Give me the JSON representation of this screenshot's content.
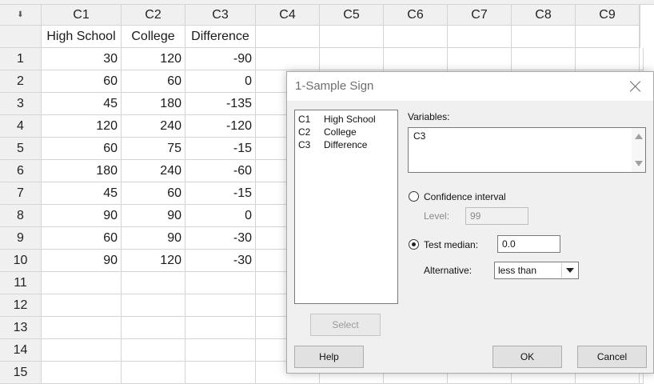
{
  "worksheet": {
    "corner_icon": "sort-arrow-icon",
    "columns": [
      "C1",
      "C2",
      "C3",
      "C4",
      "C5",
      "C6",
      "C7",
      "C8",
      "C9"
    ],
    "column_names": [
      "High School",
      "College",
      "Difference",
      "",
      "",
      "",
      "",
      "",
      ""
    ],
    "row_numbers": [
      "1",
      "2",
      "3",
      "4",
      "5",
      "6",
      "7",
      "8",
      "9",
      "10",
      "11",
      "12",
      "13",
      "14",
      "15"
    ],
    "rows": [
      [
        "30",
        "120",
        "-90"
      ],
      [
        "60",
        "60",
        "0"
      ],
      [
        "45",
        "180",
        "-135"
      ],
      [
        "120",
        "240",
        "-120"
      ],
      [
        "60",
        "75",
        "-15"
      ],
      [
        "180",
        "240",
        "-60"
      ],
      [
        "45",
        "60",
        "-15"
      ],
      [
        "90",
        "90",
        "0"
      ],
      [
        "60",
        "90",
        "-30"
      ],
      [
        "90",
        "120",
        "-30"
      ],
      [
        "",
        "",
        ""
      ],
      [
        "",
        "",
        ""
      ],
      [
        "",
        "",
        ""
      ],
      [
        "",
        "",
        ""
      ],
      [
        "",
        "",
        ""
      ]
    ]
  },
  "dialog": {
    "title": "1-Sample Sign",
    "close_icon": "close-icon",
    "variable_list": [
      {
        "id": "C1",
        "name": "High School"
      },
      {
        "id": "C2",
        "name": "College"
      },
      {
        "id": "C3",
        "name": "Difference"
      }
    ],
    "variables_label": "Variables:",
    "variables_value": "C3",
    "confidence_interval_label": "Confidence interval",
    "confidence_interval_selected": false,
    "level_label": "Level:",
    "level_value": "99",
    "test_median_label": "Test median:",
    "test_median_selected": true,
    "test_median_value": "0.0",
    "alternative_label": "Alternative:",
    "alternative_value": "less than",
    "buttons": {
      "select": "Select",
      "help": "Help",
      "ok": "OK",
      "cancel": "Cancel"
    }
  }
}
